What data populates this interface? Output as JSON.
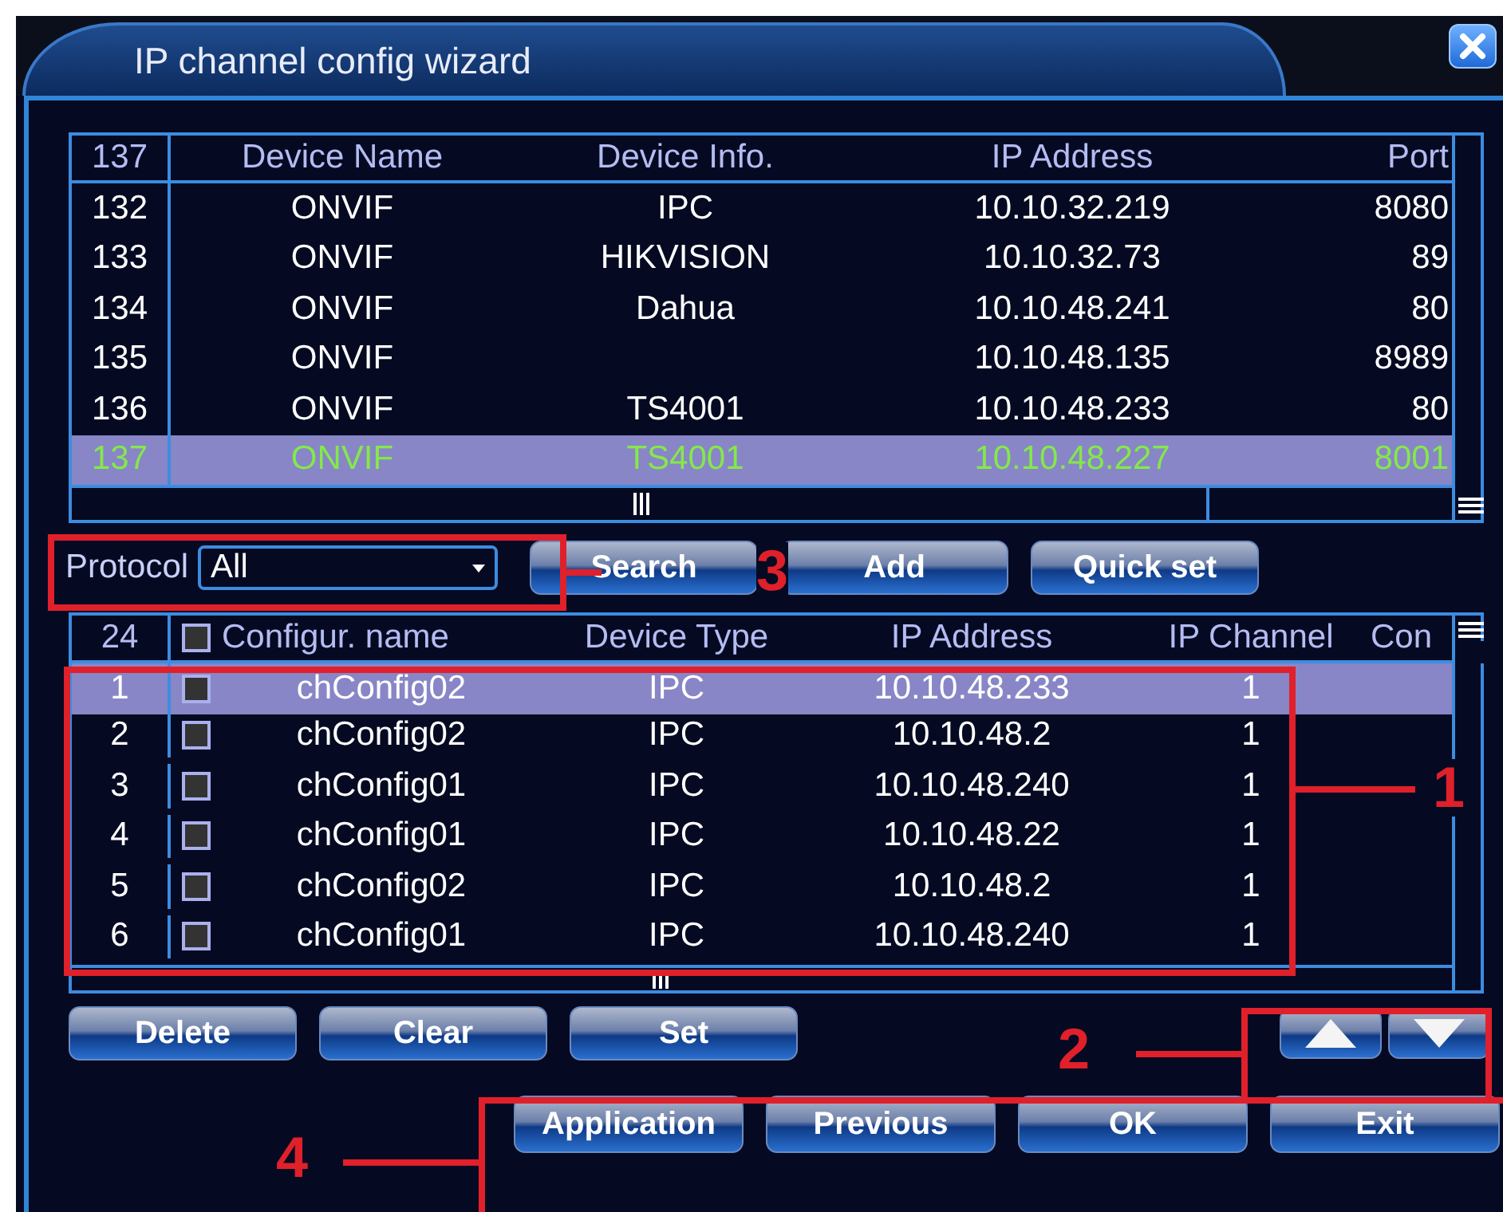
{
  "window": {
    "title": "IP channel config wizard"
  },
  "device_table": {
    "columns": [
      "137",
      "Device Name",
      "Device Info.",
      "IP Address",
      "Port"
    ],
    "rows": [
      {
        "index": "132",
        "name": "ONVIF",
        "info": "IPC",
        "ip": "10.10.32.219",
        "port": "8080",
        "selected": false
      },
      {
        "index": "133",
        "name": "ONVIF",
        "info": "HIKVISION",
        "ip": "10.10.32.73",
        "port": "89",
        "selected": false
      },
      {
        "index": "134",
        "name": "ONVIF",
        "info": "Dahua",
        "ip": "10.10.48.241",
        "port": "80",
        "selected": false
      },
      {
        "index": "135",
        "name": "ONVIF",
        "ip": "10.10.48.135",
        "port": "8989",
        "selected": false
      },
      {
        "index": "136",
        "name": "ONVIF",
        "info": "TS4001",
        "ip": "10.10.48.233",
        "port": "80",
        "selected": false
      },
      {
        "index": "137",
        "name": "ONVIF",
        "info": "TS4001",
        "ip": "10.10.48.227",
        "port": "8001",
        "selected": true
      }
    ]
  },
  "protocol": {
    "label": "Protocol",
    "value": "All"
  },
  "search_buttons": [
    "Search",
    "Add",
    "Quick set"
  ],
  "channel_table": {
    "columns": [
      "24",
      "Configur. name",
      "Device Type",
      "IP Address",
      "IP Channel",
      "Con"
    ],
    "header_checked": false,
    "rows": [
      {
        "index": "1",
        "checked": false,
        "name": "chConfig02",
        "type": "IPC",
        "ip": "10.10.48.233",
        "channel": "1",
        "selected": true
      },
      {
        "index": "2",
        "checked": false,
        "name": "chConfig02",
        "type": "IPC",
        "ip": "10.10.48.2",
        "channel": "1",
        "selected": false
      },
      {
        "index": "3",
        "checked": false,
        "name": "chConfig01",
        "type": "IPC",
        "ip": "10.10.48.240",
        "channel": "1",
        "selected": false
      },
      {
        "index": "4",
        "checked": false,
        "name": "chConfig01",
        "type": "IPC",
        "ip": "10.10.48.22",
        "channel": "1",
        "selected": false
      },
      {
        "index": "5",
        "checked": false,
        "name": "chConfig02",
        "type": "IPC",
        "ip": "10.10.48.2",
        "channel": "1",
        "selected": false
      },
      {
        "index": "6",
        "checked": false,
        "name": "chConfig01",
        "type": "IPC",
        "ip": "10.10.48.240",
        "channel": "1",
        "selected": false
      }
    ]
  },
  "edit_buttons": [
    "Delete",
    "Clear",
    "Set"
  ],
  "footer_buttons": [
    "Application",
    "Previous",
    "OK",
    "Exit"
  ],
  "annotations": [
    {
      "label": "1"
    },
    {
      "label": "2"
    },
    {
      "label": "3"
    },
    {
      "label": "4"
    }
  ]
}
